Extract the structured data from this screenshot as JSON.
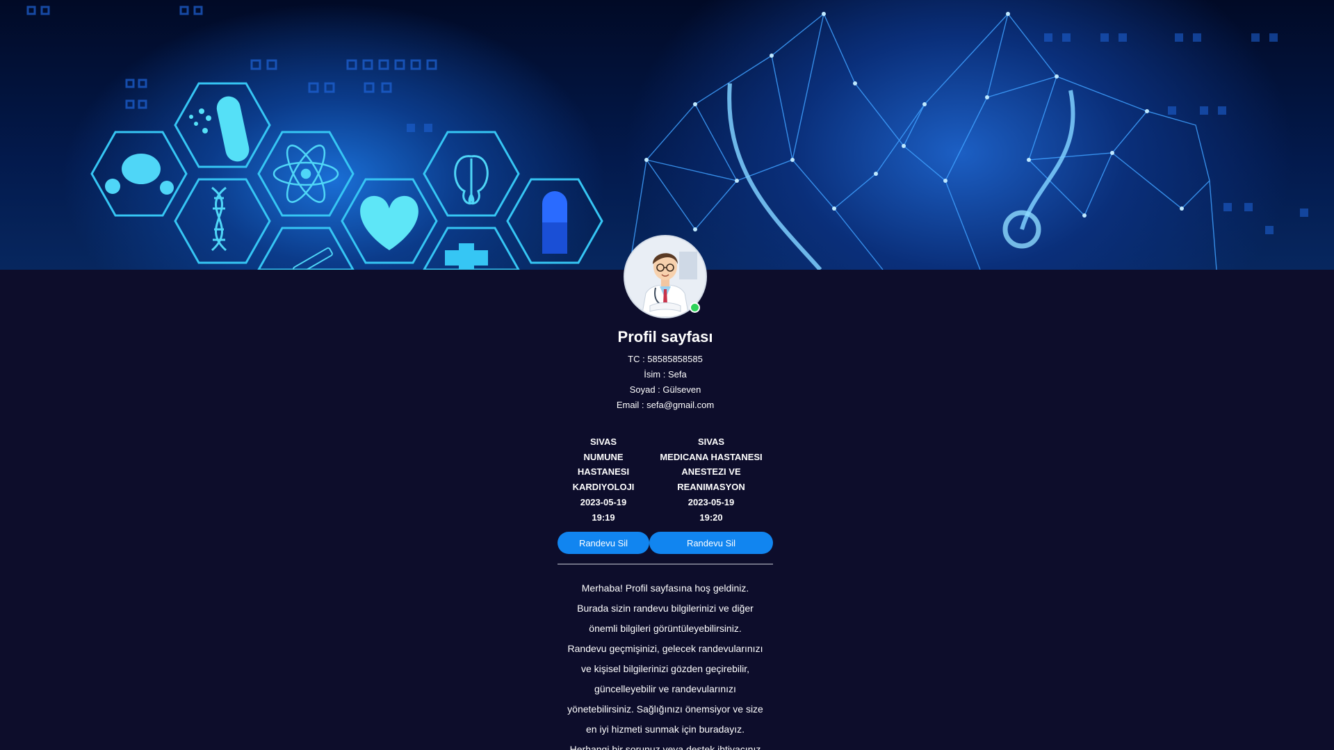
{
  "profile": {
    "title": "Profil sayfası",
    "tc": "TC : 58585858585",
    "name": "İsim : Sefa",
    "surname": "Soyad : Gülseven",
    "email": "Email : sefa@gmail.com"
  },
  "appointments": [
    {
      "lines": [
        "SIVAS",
        "NUMUNE",
        "HASTANESI",
        "KARDIYOLOJI",
        "2023-05-19",
        "19:19"
      ],
      "button": "Randevu Sil"
    },
    {
      "lines": [
        "SIVAS",
        "MEDICANA HASTANESI",
        "ANESTEZI VE",
        "REANIMASYON",
        "2023-05-19",
        "19:20"
      ],
      "button": "Randevu Sil"
    }
  ],
  "welcome_lines": [
    "Merhaba! Profil sayfasına hoş geldiniz.",
    "Burada sizin randevu bilgilerinizi ve diğer",
    "önemli bilgileri görüntüleyebilirsiniz.",
    "Randevu geçmişinizi, gelecek randevularınızı",
    "ve kişisel bilgilerinizi gözden geçirebilir,",
    "güncelleyebilir ve randevularınızı",
    "yönetebilirsiniz. Sağlığınızı önemsiyor ve size",
    "en iyi hizmeti sunmak için buradayız.",
    "Herhangi bir sorunuz veya destek ihtiyacınız"
  ],
  "colors": {
    "background": "#0d0d2b",
    "button": "#1185f0",
    "status_online": "#2ed35a"
  },
  "icons": {
    "avatar": "doctor-avatar",
    "status": "online-status-dot"
  }
}
